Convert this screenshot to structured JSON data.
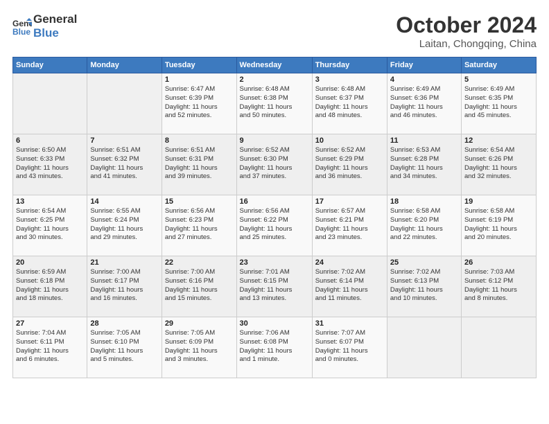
{
  "header": {
    "logo_line1": "General",
    "logo_line2": "Blue",
    "month": "October 2024",
    "location": "Laitan, Chongqing, China"
  },
  "weekdays": [
    "Sunday",
    "Monday",
    "Tuesday",
    "Wednesday",
    "Thursday",
    "Friday",
    "Saturday"
  ],
  "weeks": [
    [
      {
        "day": "",
        "info": ""
      },
      {
        "day": "",
        "info": ""
      },
      {
        "day": "1",
        "info": "Sunrise: 6:47 AM\nSunset: 6:39 PM\nDaylight: 11 hours\nand 52 minutes."
      },
      {
        "day": "2",
        "info": "Sunrise: 6:48 AM\nSunset: 6:38 PM\nDaylight: 11 hours\nand 50 minutes."
      },
      {
        "day": "3",
        "info": "Sunrise: 6:48 AM\nSunset: 6:37 PM\nDaylight: 11 hours\nand 48 minutes."
      },
      {
        "day": "4",
        "info": "Sunrise: 6:49 AM\nSunset: 6:36 PM\nDaylight: 11 hours\nand 46 minutes."
      },
      {
        "day": "5",
        "info": "Sunrise: 6:49 AM\nSunset: 6:35 PM\nDaylight: 11 hours\nand 45 minutes."
      }
    ],
    [
      {
        "day": "6",
        "info": "Sunrise: 6:50 AM\nSunset: 6:33 PM\nDaylight: 11 hours\nand 43 minutes."
      },
      {
        "day": "7",
        "info": "Sunrise: 6:51 AM\nSunset: 6:32 PM\nDaylight: 11 hours\nand 41 minutes."
      },
      {
        "day": "8",
        "info": "Sunrise: 6:51 AM\nSunset: 6:31 PM\nDaylight: 11 hours\nand 39 minutes."
      },
      {
        "day": "9",
        "info": "Sunrise: 6:52 AM\nSunset: 6:30 PM\nDaylight: 11 hours\nand 37 minutes."
      },
      {
        "day": "10",
        "info": "Sunrise: 6:52 AM\nSunset: 6:29 PM\nDaylight: 11 hours\nand 36 minutes."
      },
      {
        "day": "11",
        "info": "Sunrise: 6:53 AM\nSunset: 6:28 PM\nDaylight: 11 hours\nand 34 minutes."
      },
      {
        "day": "12",
        "info": "Sunrise: 6:54 AM\nSunset: 6:26 PM\nDaylight: 11 hours\nand 32 minutes."
      }
    ],
    [
      {
        "day": "13",
        "info": "Sunrise: 6:54 AM\nSunset: 6:25 PM\nDaylight: 11 hours\nand 30 minutes."
      },
      {
        "day": "14",
        "info": "Sunrise: 6:55 AM\nSunset: 6:24 PM\nDaylight: 11 hours\nand 29 minutes."
      },
      {
        "day": "15",
        "info": "Sunrise: 6:56 AM\nSunset: 6:23 PM\nDaylight: 11 hours\nand 27 minutes."
      },
      {
        "day": "16",
        "info": "Sunrise: 6:56 AM\nSunset: 6:22 PM\nDaylight: 11 hours\nand 25 minutes."
      },
      {
        "day": "17",
        "info": "Sunrise: 6:57 AM\nSunset: 6:21 PM\nDaylight: 11 hours\nand 23 minutes."
      },
      {
        "day": "18",
        "info": "Sunrise: 6:58 AM\nSunset: 6:20 PM\nDaylight: 11 hours\nand 22 minutes."
      },
      {
        "day": "19",
        "info": "Sunrise: 6:58 AM\nSunset: 6:19 PM\nDaylight: 11 hours\nand 20 minutes."
      }
    ],
    [
      {
        "day": "20",
        "info": "Sunrise: 6:59 AM\nSunset: 6:18 PM\nDaylight: 11 hours\nand 18 minutes."
      },
      {
        "day": "21",
        "info": "Sunrise: 7:00 AM\nSunset: 6:17 PM\nDaylight: 11 hours\nand 16 minutes."
      },
      {
        "day": "22",
        "info": "Sunrise: 7:00 AM\nSunset: 6:16 PM\nDaylight: 11 hours\nand 15 minutes."
      },
      {
        "day": "23",
        "info": "Sunrise: 7:01 AM\nSunset: 6:15 PM\nDaylight: 11 hours\nand 13 minutes."
      },
      {
        "day": "24",
        "info": "Sunrise: 7:02 AM\nSunset: 6:14 PM\nDaylight: 11 hours\nand 11 minutes."
      },
      {
        "day": "25",
        "info": "Sunrise: 7:02 AM\nSunset: 6:13 PM\nDaylight: 11 hours\nand 10 minutes."
      },
      {
        "day": "26",
        "info": "Sunrise: 7:03 AM\nSunset: 6:12 PM\nDaylight: 11 hours\nand 8 minutes."
      }
    ],
    [
      {
        "day": "27",
        "info": "Sunrise: 7:04 AM\nSunset: 6:11 PM\nDaylight: 11 hours\nand 6 minutes."
      },
      {
        "day": "28",
        "info": "Sunrise: 7:05 AM\nSunset: 6:10 PM\nDaylight: 11 hours\nand 5 minutes."
      },
      {
        "day": "29",
        "info": "Sunrise: 7:05 AM\nSunset: 6:09 PM\nDaylight: 11 hours\nand 3 minutes."
      },
      {
        "day": "30",
        "info": "Sunrise: 7:06 AM\nSunset: 6:08 PM\nDaylight: 11 hours\nand 1 minute."
      },
      {
        "day": "31",
        "info": "Sunrise: 7:07 AM\nSunset: 6:07 PM\nDaylight: 11 hours\nand 0 minutes."
      },
      {
        "day": "",
        "info": ""
      },
      {
        "day": "",
        "info": ""
      }
    ]
  ]
}
